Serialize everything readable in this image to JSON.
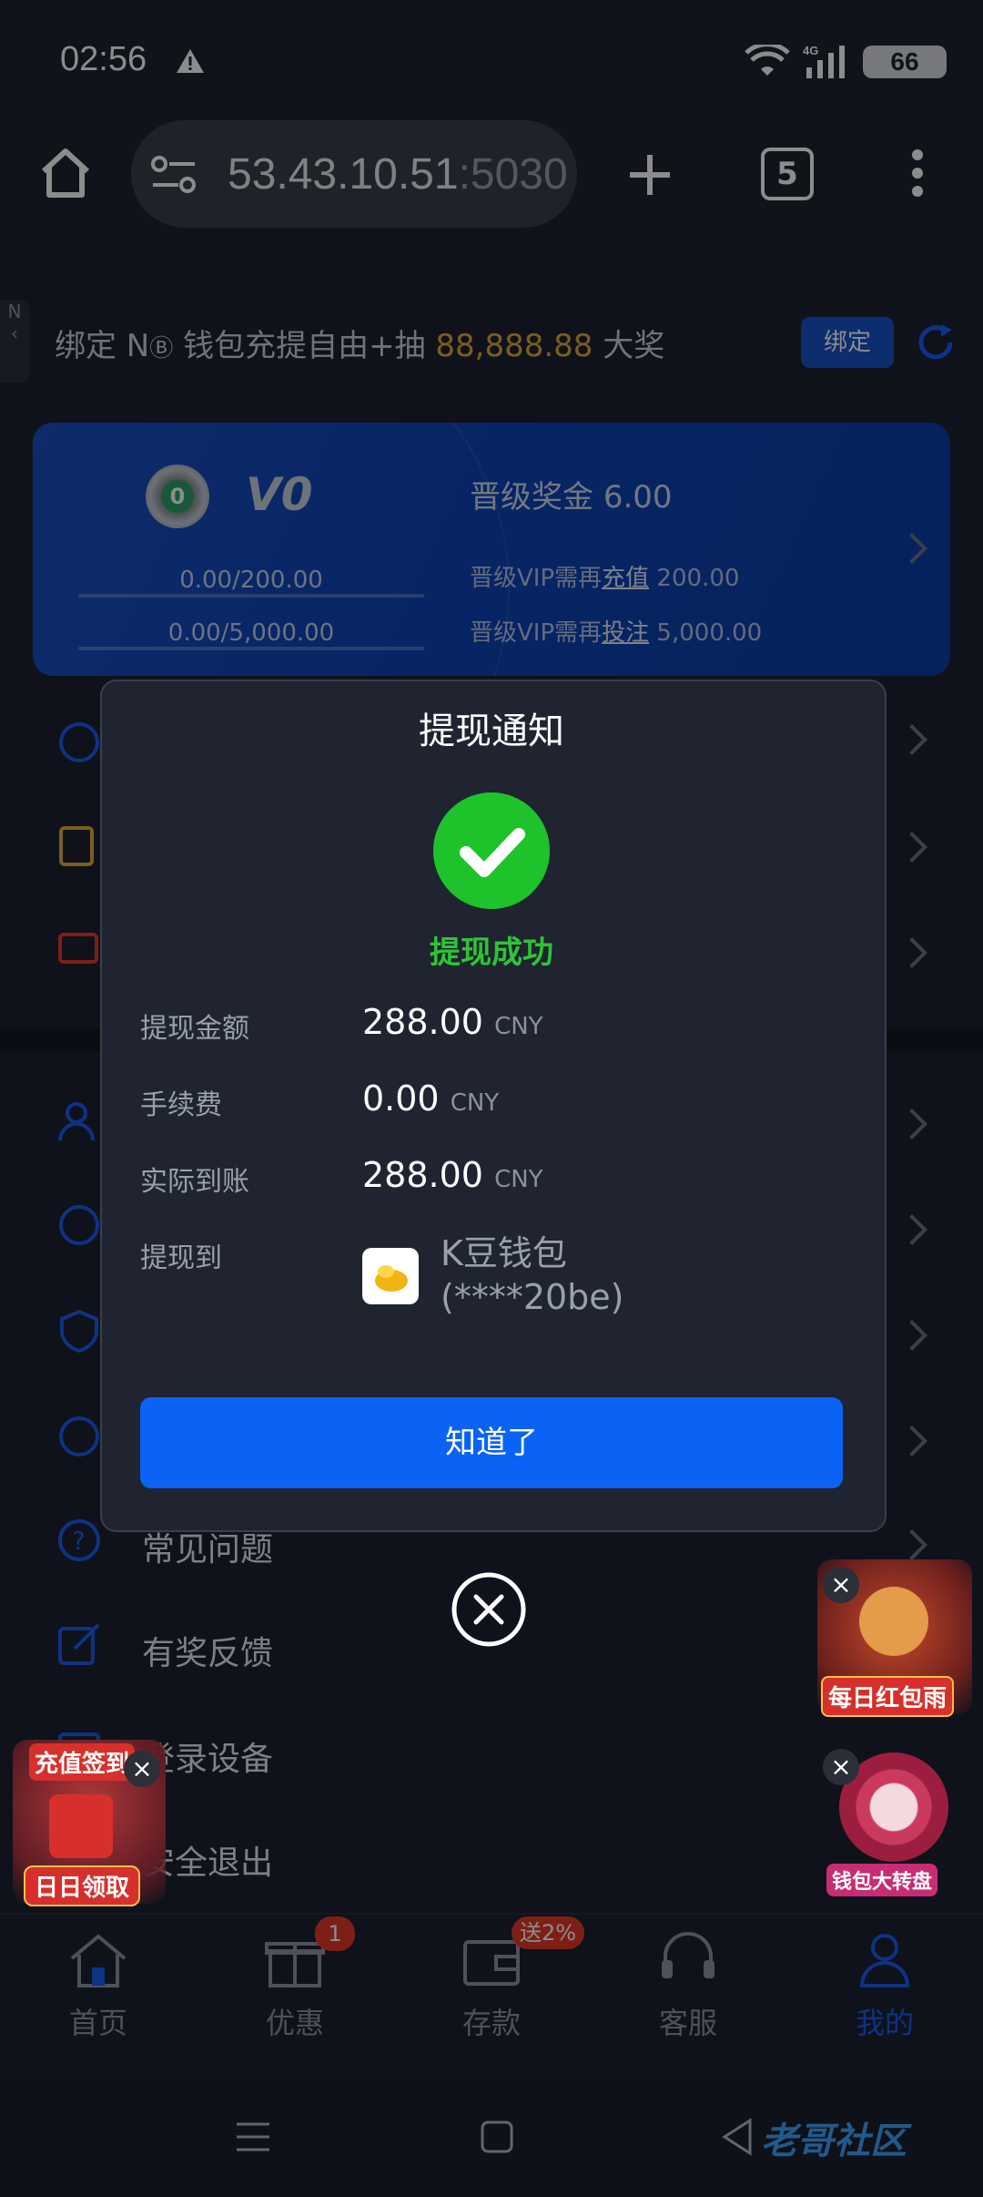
{
  "status_bar": {
    "time": "02:56",
    "battery": "66",
    "network": "4G"
  },
  "browser": {
    "url_host": "53.43.10.51",
    "url_port": ":5030",
    "tab_count": "5"
  },
  "banner": {
    "text_before": "绑定 N",
    "text_middle": " 钱包充提自由+抽 ",
    "amount": "88,888.88",
    "text_after": " 大奖",
    "bind_label": "绑定",
    "side_tab": "N"
  },
  "vip": {
    "badge_level": "0",
    "level": "V0",
    "progress_deposit": "0.00/200.00",
    "progress_bet": "0.00/5,000.00",
    "bonus_label": "晋级奖金",
    "bonus_value": "6.00",
    "need_deposit_prefix": "晋级VIP需再",
    "need_deposit_link": "充值",
    "need_deposit_value": "200.00",
    "need_bet_prefix": "晋级VIP需再",
    "need_bet_link": "投注",
    "need_bet_value": "5,000.00",
    "deposit_fill": 0,
    "bet_fill": 0
  },
  "menu": {
    "faq": "常见问题",
    "feedback": "有奖反馈",
    "devices": "登录设备",
    "logout": "安全退出"
  },
  "modal": {
    "title": "提现通知",
    "status": "提现成功",
    "amount_label": "提现金额",
    "amount_value": "288.00",
    "amount_currency": "CNY",
    "fee_label": "手续费",
    "fee_value": "0.00",
    "fee_currency": "CNY",
    "received_label": "实际到账",
    "received_value": "288.00",
    "received_currency": "CNY",
    "to_label": "提现到",
    "wallet_name": "K豆钱包",
    "wallet_account": "(****20be)",
    "confirm_label": "知道了"
  },
  "promos": {
    "left_top": "充值签到",
    "left_bottom": "日日领取",
    "right_top": "每日红包雨",
    "right_bottom": "钱包大转盘"
  },
  "bottom_nav": [
    {
      "label": "首页",
      "icon": "home-icon"
    },
    {
      "label": "优惠",
      "icon": "gift-icon",
      "badge": "1"
    },
    {
      "label": "存款",
      "icon": "wallet-icon",
      "badge": "送2%"
    },
    {
      "label": "客服",
      "icon": "headset-icon"
    },
    {
      "label": "我的",
      "icon": "user-icon",
      "active": true
    }
  ],
  "watermark": "老哥社区",
  "colors": {
    "accent": "#0a63f5",
    "success": "#1ec22a",
    "gold": "#e2a93a",
    "active_nav": "#1a5bf0"
  }
}
